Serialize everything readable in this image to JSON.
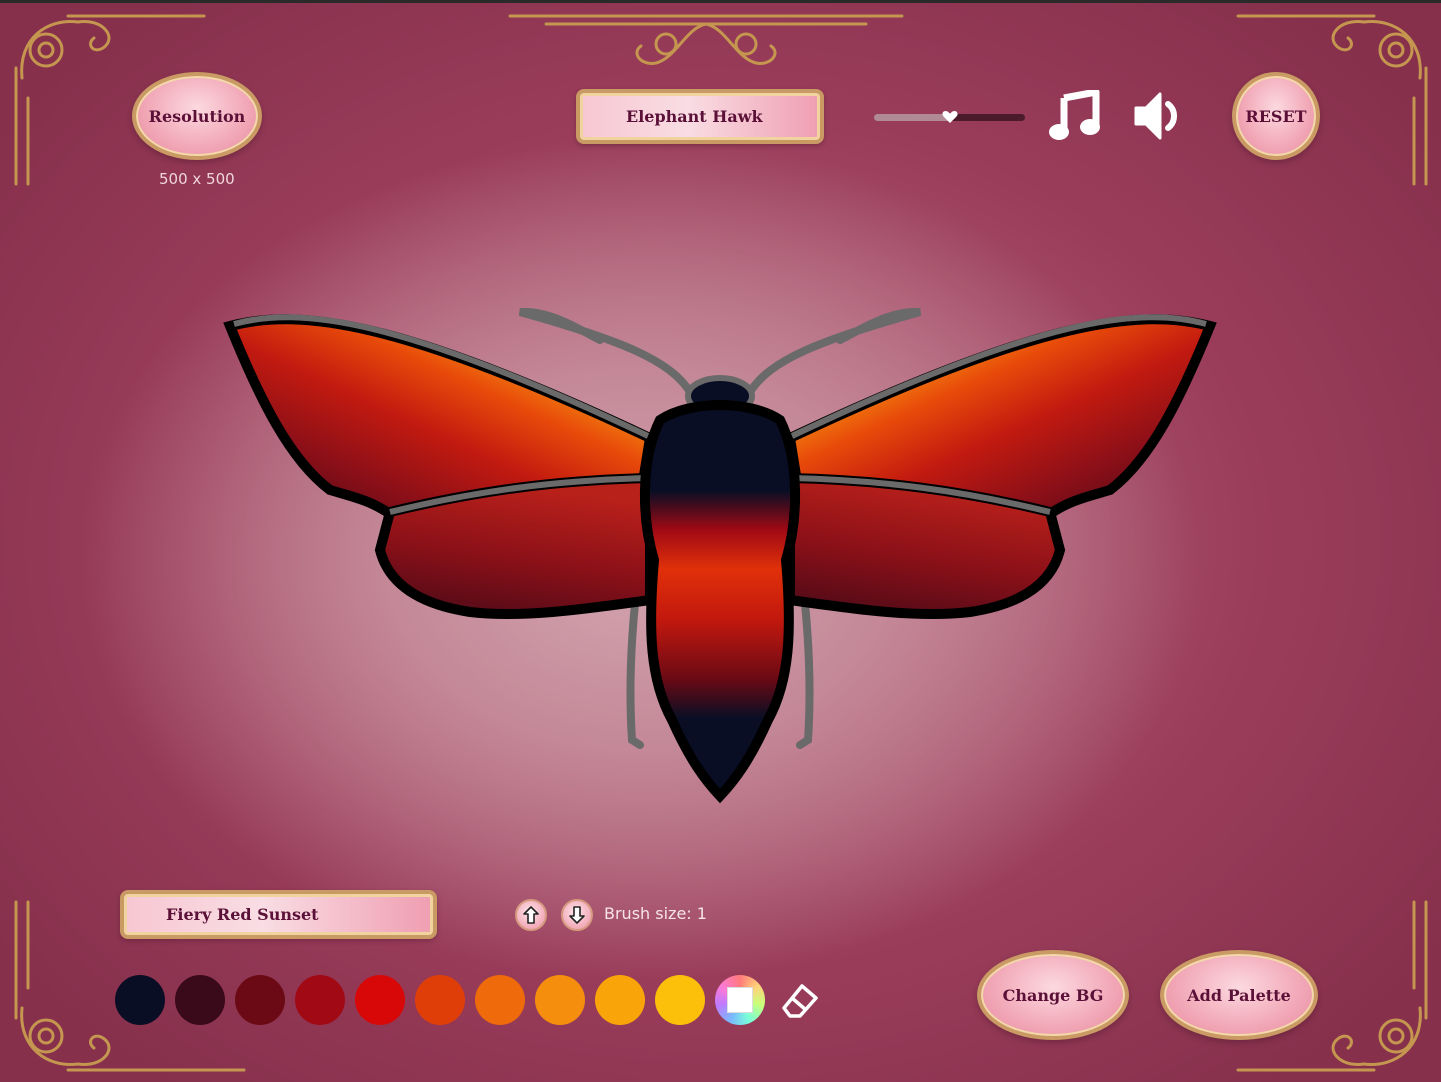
{
  "header": {
    "resolution_button": "Resolution",
    "resolution_value": "500 x 500",
    "species_selector": "Elephant Hawk",
    "volume_level": 0.5,
    "reset_button": "RESET"
  },
  "toolbar": {
    "palette_selector": "Fiery Red Sunset",
    "brush_size_label": "Brush size: 1",
    "change_bg_button": "Change BG",
    "add_palette_button": "Add Palette"
  },
  "palette": {
    "colors": [
      "#0a0e24",
      "#3a0a1a",
      "#6b0a14",
      "#a10a14",
      "#d90808",
      "#e03e08",
      "#ef6a0a",
      "#f58e0c",
      "#f9a50a",
      "#fcbf0a"
    ]
  },
  "icons": {
    "music": "music-note-icon",
    "sound": "speaker-icon",
    "eraser": "eraser-icon",
    "color_picker": "color-wheel-icon",
    "brush_up": "arrow-up-icon",
    "brush_down": "arrow-down-icon"
  }
}
